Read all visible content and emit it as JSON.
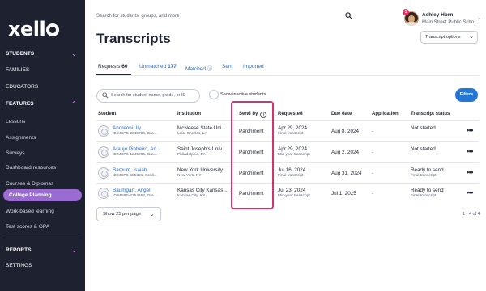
{
  "app": {
    "logo": "xello"
  },
  "sidebar": {
    "items": [
      {
        "label": "STUDENTS",
        "chevron": "v"
      },
      {
        "label": "FAMILIES"
      },
      {
        "label": "EDUCATORS"
      },
      {
        "label": "FEATURES",
        "chevron": "^"
      },
      {
        "label": "Lessons"
      },
      {
        "label": "Assignments"
      },
      {
        "label": "Surveys"
      },
      {
        "label": "Dashboard resources"
      },
      {
        "label": "Courses & Diplomas"
      },
      {
        "label": "College Planning"
      },
      {
        "label": "Work-based learning"
      },
      {
        "label": "Test scores & GPA"
      },
      {
        "label": "REPORTS",
        "chevron": "v"
      },
      {
        "label": "SETTINGS"
      }
    ]
  },
  "header": {
    "search_placeholder": "Search for students, groups, and more",
    "notification_count": "1",
    "user_name": "Ashley Horn",
    "user_school": "Main Street Public Scho...",
    "page_title": "Transcripts",
    "options_label": "Transcript options"
  },
  "tabs": [
    {
      "label": "Requests",
      "count": "60"
    },
    {
      "label": "Unmatched",
      "count": "177"
    },
    {
      "label": "Matched ⓘ",
      "count": ""
    },
    {
      "label": "Sent",
      "count": ""
    },
    {
      "label": "Imported",
      "count": ""
    }
  ],
  "toolbar": {
    "search_placeholder": "Search for student name, grade, or ID",
    "inactive_label": "Show inactive students",
    "filters_label": "Filters"
  },
  "table": {
    "columns": [
      "Student",
      "Institution",
      "Send by",
      "Requested",
      "Due date",
      "Application",
      "Transcript status"
    ],
    "rows": [
      {
        "name": "Andreoni, Ily",
        "id": "ID MSPS-2345786, Gra...",
        "institution": "McNeese State Uni...",
        "location": "Lake Charles, LA",
        "send_by": "Parchment",
        "requested": "Apr 29, 2024",
        "req_type": "Final transcript",
        "due": "Aug 8, 2024",
        "application": "-",
        "status": "Not started",
        "status_sub": ""
      },
      {
        "name": "Araujo Pinheiro, An...",
        "id": "ID MSPS-1245786, Gra...",
        "institution": "Saint Joseph's Univ...",
        "location": "Philadelphia, PA",
        "send_by": "Parchment",
        "requested": "Apr 29, 2024",
        "req_type": "Mid-year transcript",
        "due": "Aug 2, 2024",
        "application": "-",
        "status": "Not started",
        "status_sub": ""
      },
      {
        "name": "Barnum, Isaiah",
        "id": "ID MSPS-555321, Grad...",
        "institution": "New York University",
        "location": "New York, NY",
        "send_by": "Parchment",
        "requested": "Jul 16, 2024",
        "req_type": "Final transcript",
        "due": "Aug 31, 2024",
        "application": "-",
        "status": "Ready to send",
        "status_sub": "Final transcript"
      },
      {
        "name": "Baumgart, Angel",
        "id": "ID MSPS-2154652, Gra...",
        "institution": "Kansas City Kansas ...",
        "location": "Kansas City, KS",
        "send_by": "Parchment",
        "requested": "Jul 23, 2024",
        "req_type": "Mid-year transcript",
        "due": "Jul 1, 2025",
        "application": "-",
        "status": "Ready to send",
        "status_sub": "Final transcript"
      }
    ]
  },
  "footer": {
    "per_page": "Show 25 per page",
    "range": "1 - 4 of 4"
  },
  "colors": {
    "sidebar_bg": "#1e2130",
    "active_nav": "#9a6bd0",
    "link": "#2a6bc2",
    "primary_button": "#2477d4",
    "highlight": "#d6336c"
  }
}
